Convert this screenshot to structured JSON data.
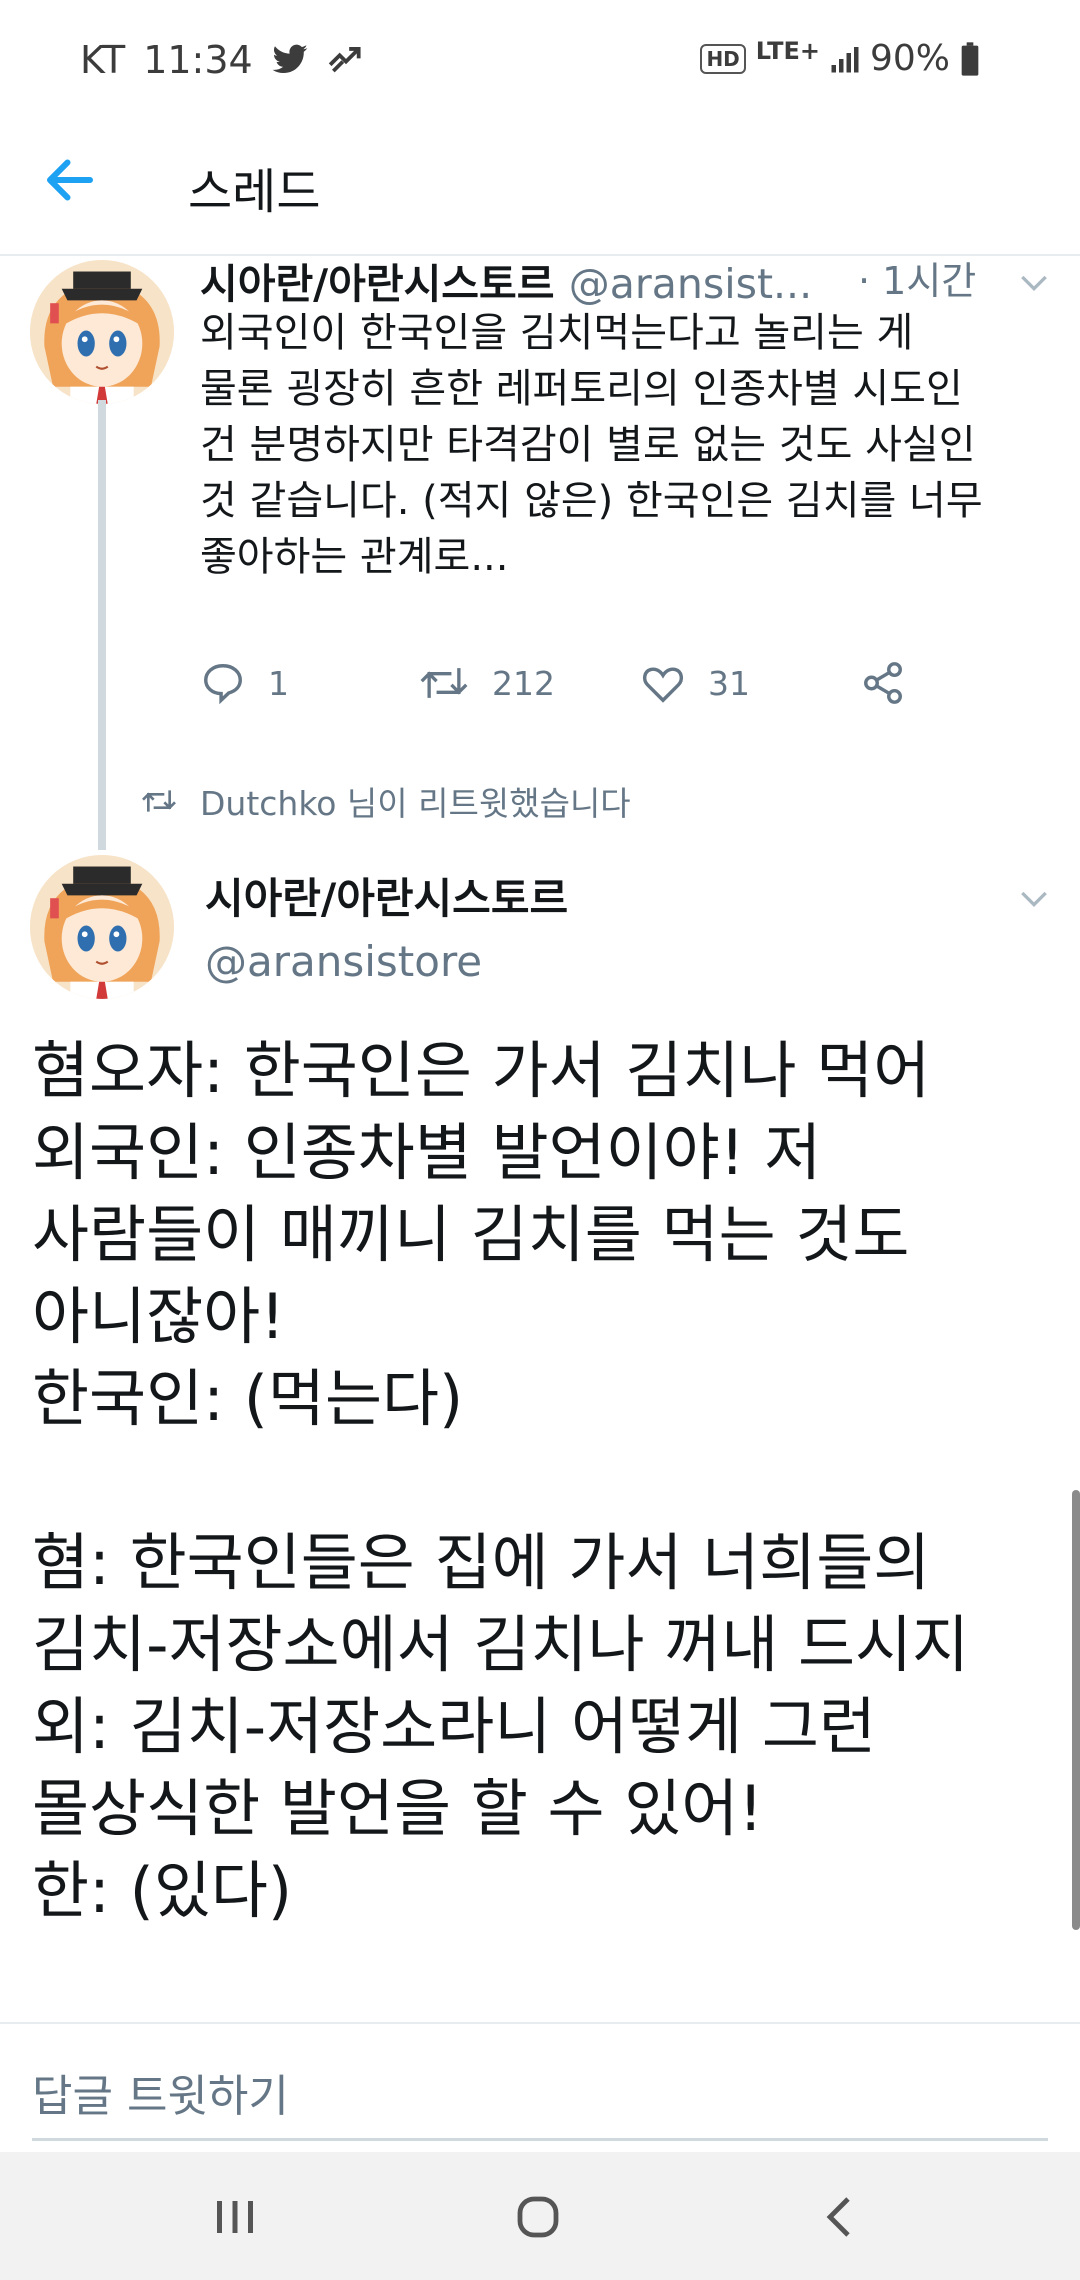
{
  "status_bar": {
    "carrier": "KT",
    "time": "11:34",
    "network": "LTE+",
    "hd_label": "HD",
    "battery": "90%"
  },
  "header": {
    "title": "스레드"
  },
  "parent_tweet": {
    "name": "시아란/아란시스토르",
    "handle": "@aransist...",
    "time": "· 1시간",
    "text": "외국인이 한국인을 김치먹는다고 놀리는 게\n물론 굉장히 흔한 레퍼토리의 인종차별 시도인\n건 분명하지만 타격감이 별로 없는 것도 사실인\n것 같습니다. (적지 않은) 한국인은 김치를 너무\n좋아하는 관계로...",
    "replies": "1",
    "retweets": "212",
    "likes": "31"
  },
  "retweet_note": "Dutchko 님이 리트윗했습니다",
  "main_tweet": {
    "name": "시아란/아란시스토르",
    "handle": "@aransistore",
    "text": "혐오자: 한국인은 가서 김치나 먹어\n외국인: 인종차별 발언이야! 저\n사람들이 매끼니 김치를 먹는 것도\n아니잖아!\n한국인: (먹는다)\n\n혐: 한국인들은 집에 가서 너희들의\n김치-저장소에서 김치나 꺼내 드시지\n외: 김치-저장소라니 어떻게 그런\n몰상식한 발언을 할 수 있어!\n한: (있다)"
  },
  "reply_placeholder": "답글 트윗하기",
  "colors": {
    "accent": "#1da1f2",
    "secondary_text": "#657786",
    "primary_text": "#14171a"
  }
}
